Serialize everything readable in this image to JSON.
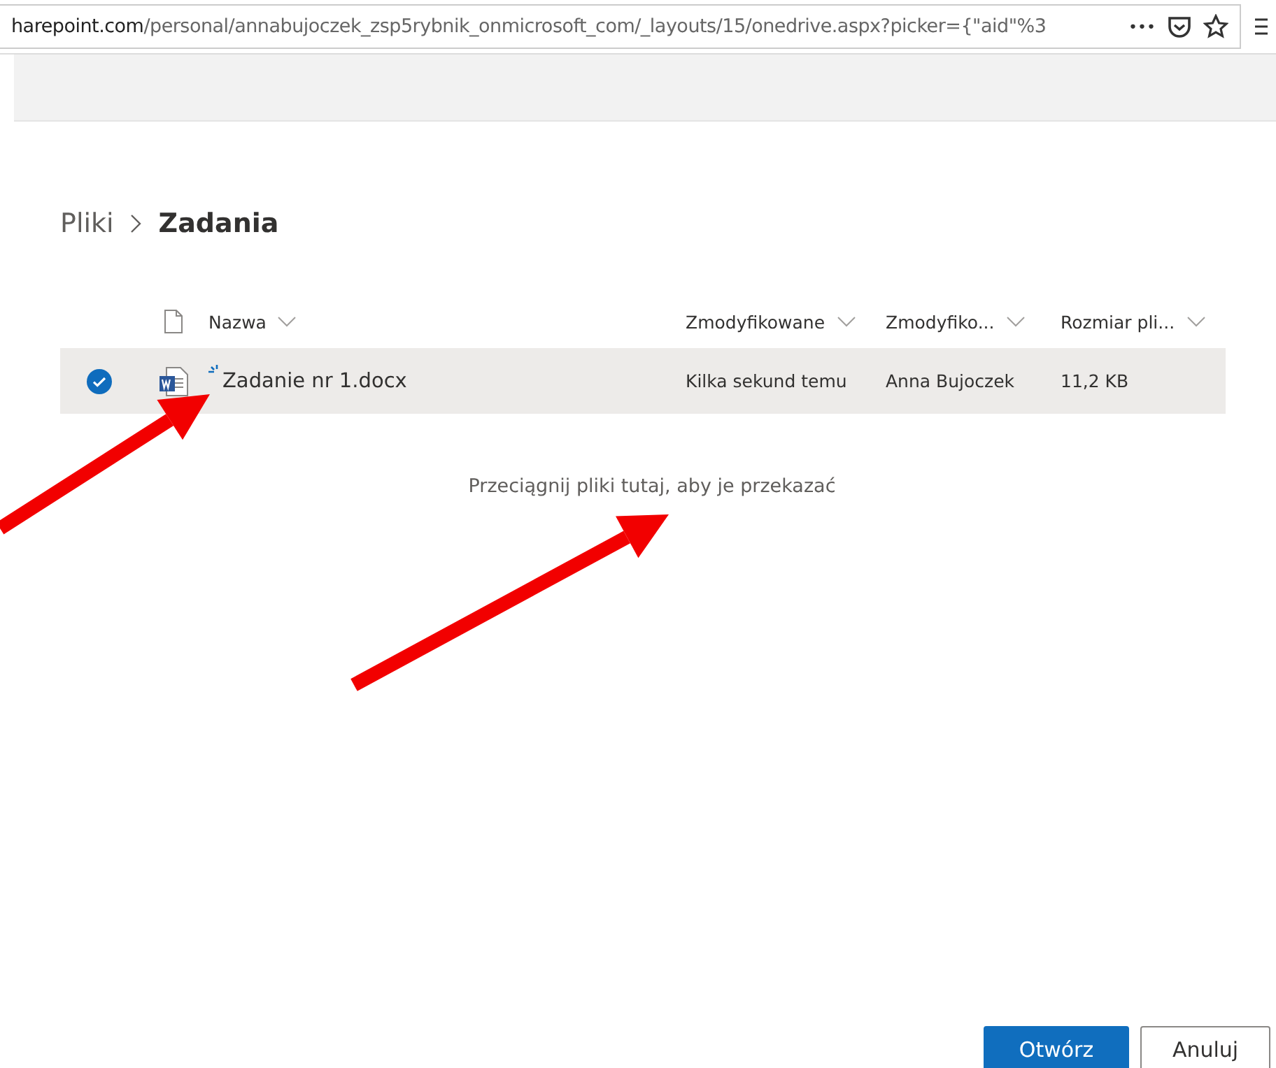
{
  "address_bar": {
    "host": "harepoint.com",
    "path": "/personal/annabujoczek_zsp5rybnik_onmicrosoft_com/_layouts/15/onedrive.aspx?picker={\"aid\"%3",
    "more": "•••"
  },
  "breadcrumb": [
    {
      "label": "Pliki",
      "selected": false
    },
    {
      "label": "Zadania",
      "selected": true
    }
  ],
  "table": {
    "columns": [
      "Nazwa",
      "Zmodyfikowane",
      "Zmodyfiko...",
      "Rozmiar pli..."
    ],
    "rows": [
      {
        "selected": true,
        "loading": true,
        "name": "Zadanie nr 1.docx",
        "modified": "Kilka sekund temu",
        "modified_by": "Anna Bujoczek",
        "size": "11,2 KB"
      }
    ]
  },
  "drop_hint": "Przeciągnij pliki tutaj, aby je przekazać",
  "buttons": [
    {
      "label": "Otwórz",
      "kind": "primary"
    },
    {
      "label": "Anuluj",
      "kind": "secondary"
    }
  ],
  "annotations": [
    {
      "kind": "arrow"
    },
    {
      "kind": "arrow"
    }
  ]
}
